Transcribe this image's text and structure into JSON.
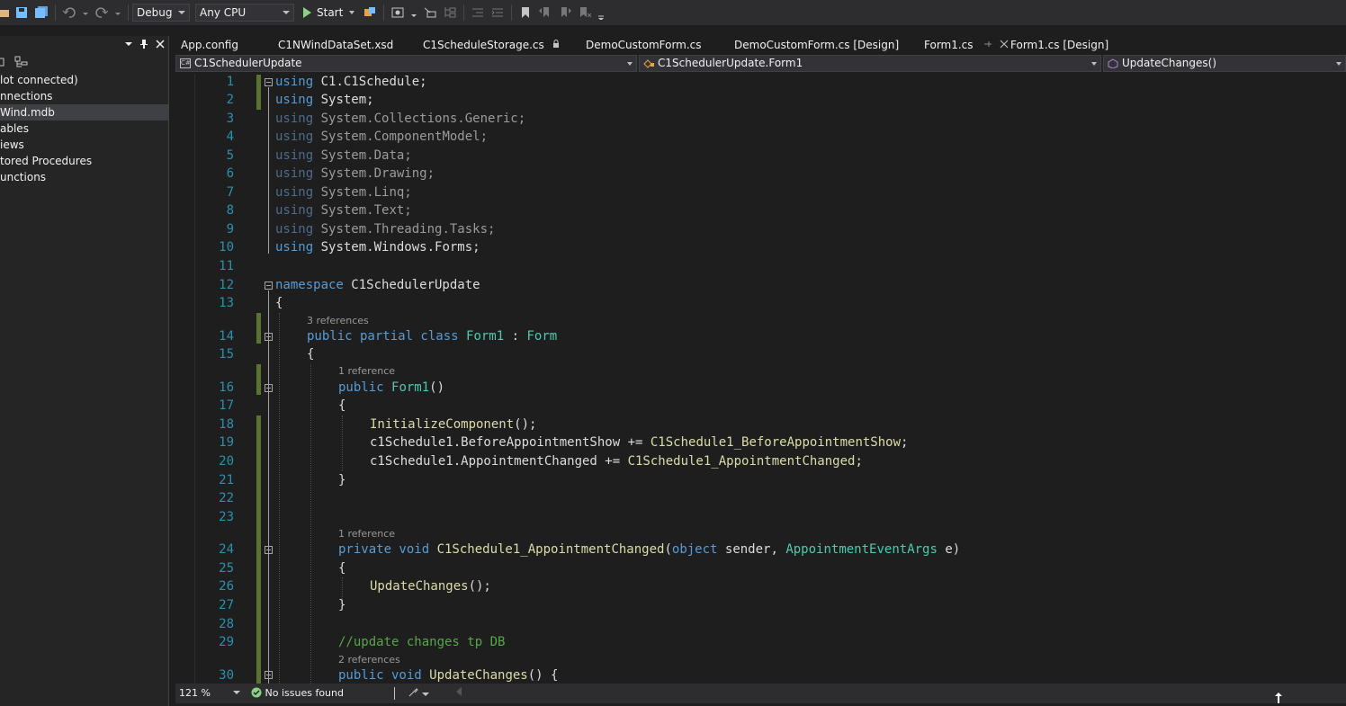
{
  "toolbar": {
    "configuration": "Debug",
    "platform": "Any CPU",
    "start_label": "Start"
  },
  "explorer": {
    "items": [
      {
        "label": "lot connected)",
        "selected": false
      },
      {
        "label": "nnections",
        "selected": false
      },
      {
        "label": "Wind.mdb",
        "selected": true
      },
      {
        "label": "ables",
        "selected": false
      },
      {
        "label": "iews",
        "selected": false
      },
      {
        "label": "tored Procedures",
        "selected": false
      },
      {
        "label": "unctions",
        "selected": false
      }
    ]
  },
  "tabs": [
    {
      "label": "App.config",
      "active": false
    },
    {
      "label": "C1NWindDataSet.xsd",
      "active": false
    },
    {
      "label": "C1ScheduleStorage.cs",
      "active": false
    },
    {
      "label": "DemoCustomForm.cs",
      "active": false
    },
    {
      "label": "DemoCustomForm.cs [Design]",
      "active": false
    },
    {
      "label": "Form1.cs",
      "active": true
    },
    {
      "label": "Form1.cs [Design]",
      "active": false
    }
  ],
  "navbar": {
    "project": "C1SchedulerUpdate",
    "type": "C1SchedulerUpdate.Form1",
    "member": "UpdateChanges()"
  },
  "editor": {
    "line_numbers": [
      "1",
      "2",
      "3",
      "4",
      "5",
      "6",
      "7",
      "8",
      "9",
      "10",
      "11",
      "12",
      "13",
      "14",
      "15",
      "16",
      "17",
      "18",
      "19",
      "20",
      "21",
      "22",
      "23",
      "24",
      "25",
      "26",
      "27",
      "28",
      "29",
      "30"
    ],
    "lines": {
      "l1_kw": "using",
      "l1_rest": " C1.C1Schedule;",
      "l2_kw": "using",
      "l2_rest": " System;",
      "l3_kw": "using",
      "l3_rest": " System.Collections.Generic;",
      "l4_kw": "using",
      "l4_rest": " System.ComponentModel;",
      "l5_kw": "using",
      "l5_rest": " System.Data;",
      "l6_kw": "using",
      "l6_rest": " System.Drawing;",
      "l7_kw": "using",
      "l7_rest": " System.Linq;",
      "l8_kw": "using",
      "l8_rest": " System.Text;",
      "l9_kw": "using",
      "l9_rest": " System.Threading.Tasks;",
      "l10_kw": "using",
      "l10_rest": " System.Windows.Forms;",
      "l12_kw": "namespace",
      "l12_rest": " C1SchedulerUpdate",
      "l13": "{",
      "l14_kw": "public partial class ",
      "l14_ty": "Form1",
      "l14_mid": " : ",
      "l14_base": "Form",
      "l15": "{",
      "l16_kw": "public ",
      "l16_ty": "Form1",
      "l16_rest": "()",
      "l17": "{",
      "l18_fn": "InitializeComponent",
      "l18_rest": "();",
      "l19_a": "c1Schedule1.BeforeAppointmentShow += ",
      "l19_fn": "C1Schedule1_BeforeAppointmentShow",
      "l19_end": ";",
      "l20_a": "c1Schedule1.AppointmentChanged += ",
      "l20_fn": "C1Schedule1_AppointmentChanged",
      "l20_end": ";",
      "l21": "}",
      "l24_kw": "private void ",
      "l24_fn": "C1Schedule1_AppointmentChanged",
      "l24_p1": "(",
      "l24_kw2": "object",
      "l24_p2": " sender, ",
      "l24_ty": "AppointmentEventArgs",
      "l24_p3": " e)",
      "l25": "{",
      "l26_fn": "UpdateChanges",
      "l26_rest": "();",
      "l27": "}",
      "l29_cm": "//update changes tp DB",
      "l30_kw": "public void ",
      "l30_fn": "UpdateChanges",
      "l30_rest": "() {"
    },
    "codelens": {
      "class_refs": "3 references",
      "ctor_refs": "1 reference",
      "handler_refs": "1 reference",
      "update_refs": "2 references"
    }
  },
  "statusbar": {
    "zoom": "121 %",
    "issues": "No issues found"
  },
  "colors": {
    "keyword": "#569cd6",
    "type": "#4ec9b0",
    "method": "#dcdcaa",
    "comment": "#57a64a",
    "line_number": "#2b91af"
  }
}
